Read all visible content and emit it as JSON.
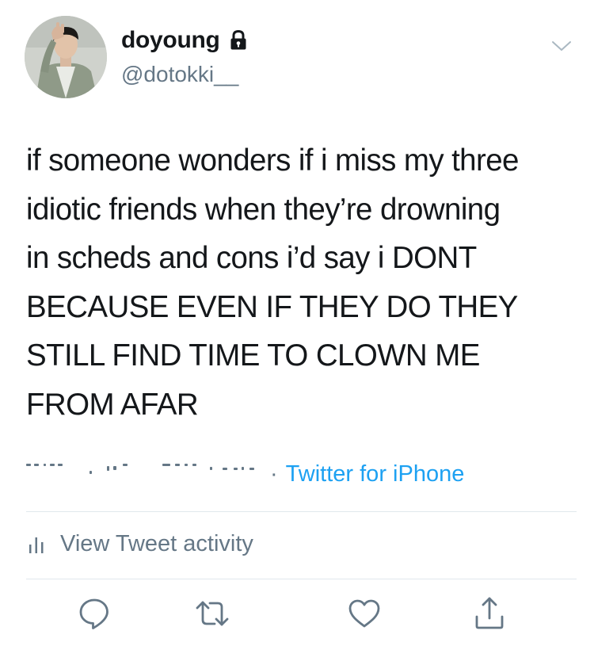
{
  "user": {
    "display_name": "doyoung",
    "handle": "@dotokki__",
    "avatar_icon": "user-avatar-photo",
    "protected_icon": "lock-icon"
  },
  "tweet": {
    "text": "if someone wonders if i miss my three\nidiotic friends when they’re drowning\nin scheds and cons i’d say i DONT\nBECAUSE EVEN IF THEY DO THEY\nSTILL FIND TIME TO CLOWN ME\nFROM AFAR",
    "separator": "·",
    "source": "Twitter for iPhone"
  },
  "activity": {
    "label": "View Tweet activity",
    "icon": "bar-chart-icon"
  },
  "actions": {
    "reply_icon": "reply-icon",
    "retweet_icon": "retweet-icon",
    "like_icon": "heart-icon",
    "share_icon": "share-icon"
  },
  "colors": {
    "text": "#14171a",
    "secondary": "#657786",
    "link": "#1da1f2",
    "divider": "#e1e8ed"
  }
}
